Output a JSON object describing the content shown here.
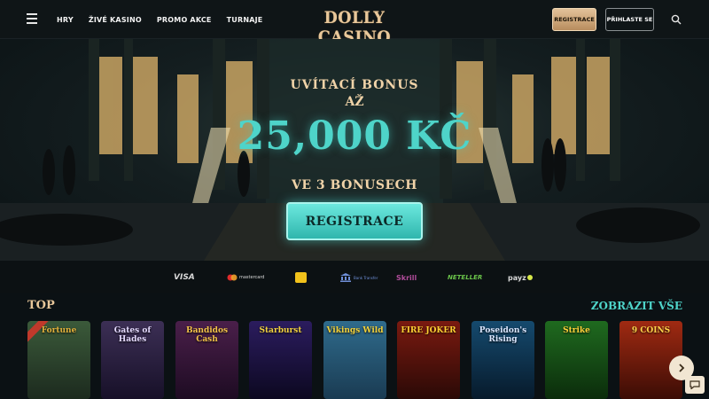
{
  "header": {
    "menu_icon": "hamburger-icon",
    "nav": [
      "HRY",
      "ŽIVÉ KASINO",
      "PROMO AKCE",
      "TURNAJE"
    ],
    "logo": "DOLLY CASINO",
    "register_label": "REGISTRACE",
    "login_label": "PŘIHLASTE SE",
    "search_icon": "search-icon"
  },
  "hero": {
    "line1": "UVÍTACÍ BONUS",
    "line2": "AŽ",
    "amount": "25,000 KČ",
    "line3": "VE 3 BONUSECH",
    "cta": "REGISTRACE"
  },
  "payments": [
    "VISA",
    "mastercard",
    "paysafecard",
    "Bank Transfer",
    "Skrill",
    "NETELLER",
    "payz"
  ],
  "top": {
    "title": "TOP",
    "view_all": "ZOBRAZIT VŠE",
    "games": [
      {
        "title": "Fortune",
        "colors": [
          "#3b5a3a",
          "#1c2a1e"
        ],
        "accent": "#e0b03c"
      },
      {
        "title": "Gates of Hades",
        "colors": [
          "#3c2f55",
          "#171028"
        ],
        "accent": "#e4d9ff"
      },
      {
        "title": "Bandidos Cash",
        "colors": [
          "#4a1f4a",
          "#1d0b22"
        ],
        "accent": "#f2c14a"
      },
      {
        "title": "Starburst",
        "colors": [
          "#2b1c5e",
          "#0c0820"
        ],
        "accent": "#f0d040"
      },
      {
        "title": "Vikings Wild",
        "colors": [
          "#2f6b8c",
          "#1a3b52"
        ],
        "accent": "#f2d23c"
      },
      {
        "title": "FIRE JOKER",
        "colors": [
          "#7a1a10",
          "#2a0906"
        ],
        "accent": "#ffcf33"
      },
      {
        "title": "Poseidon's Rising",
        "colors": [
          "#154a6e",
          "#071a2b"
        ],
        "accent": "#d9e6ff"
      },
      {
        "title": "Strike",
        "colors": [
          "#1f6a1f",
          "#0b2c0b"
        ],
        "accent": "#ffd23a"
      },
      {
        "title": "9 COINS",
        "colors": [
          "#a02a12",
          "#3b0c05"
        ],
        "accent": "#ffd24a"
      }
    ]
  },
  "colors": {
    "gold": "#e8c79a",
    "teal": "#4ed4c9",
    "background": "#0b1114"
  },
  "icons": {
    "next": "chevron-right-icon",
    "chat": "chat-icon"
  }
}
